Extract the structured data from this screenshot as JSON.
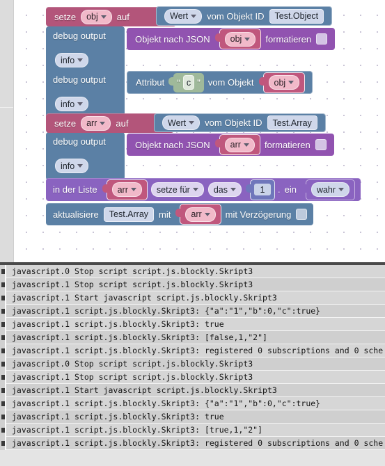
{
  "workspace": {
    "blocks": [
      {
        "id": "set-obj",
        "type": "set-variable",
        "set_label": "setze",
        "variable": "obj",
        "to_label": "auf",
        "value": {
          "type": "get-object-value",
          "mode": "Wert",
          "by_label": "vom Objekt ID",
          "object_id": "Test.Object"
        }
      },
      {
        "id": "debug-json-obj",
        "type": "debug-output",
        "header": "debug output",
        "level": "info",
        "payload": {
          "type": "object-to-json",
          "prefix_label": "Objekt nach JSON",
          "variable": "obj",
          "suffix_label": "formatieren",
          "checkbox_checked": false
        }
      },
      {
        "id": "debug-attr-c",
        "type": "debug-output",
        "header": "debug output",
        "level": "info",
        "payload": {
          "type": "object-attribute",
          "prefix_label": "Attribut",
          "attribute": "c",
          "middle_label": "vom Objekt",
          "variable": "obj"
        }
      },
      {
        "id": "set-arr",
        "type": "set-variable",
        "set_label": "setze",
        "variable": "arr",
        "to_label": "auf",
        "value": {
          "type": "get-object-value",
          "mode": "Wert",
          "by_label": "vom Objekt ID",
          "object_id": "Test.Array"
        }
      },
      {
        "id": "debug-json-arr",
        "type": "debug-output",
        "header": "debug output",
        "level": "info",
        "payload": {
          "type": "object-to-json",
          "prefix_label": "Objekt nach JSON",
          "variable": "arr",
          "suffix_label": "formatieren",
          "checkbox_checked": false
        }
      },
      {
        "id": "list-set",
        "type": "list-set-index",
        "in_list_label": "in der Liste",
        "list_variable": "arr",
        "action": "setze für",
        "position": "das",
        "index": "1",
        "insert_label": "ein",
        "value_variable": "wahr",
        "separator": "."
      },
      {
        "id": "update-state",
        "type": "update-object",
        "update_label": "aktualisiere",
        "object_id": "Test.Array",
        "with_label": "mit",
        "variable": "arr",
        "delay_label": "mit Verzögerung",
        "delay_checked": false
      }
    ],
    "colors": {
      "set_variable": "#b3557a",
      "debug_output": "#5b80a5",
      "object_to_json": "#9153b0",
      "list_block": "#8a63c0",
      "value_block": "#5b80a5",
      "variable_field": "#c0577d"
    }
  },
  "log": {
    "rows": [
      {
        "source": "javascript.0",
        "message": "Stop script script.js.blockly.Skript3",
        "text": "javascript.0 Stop script script.js.blockly.Skript3"
      },
      {
        "source": "javascript.1",
        "message": "Stop script script.js.blockly.Skript3",
        "text": "javascript.1 Stop script script.js.blockly.Skript3"
      },
      {
        "source": "javascript.1",
        "message": "Start javascript script.js.blockly.Skript3",
        "text": "javascript.1 Start javascript script.js.blockly.Skript3"
      },
      {
        "source": "javascript.1",
        "message": "script.js.blockly.Skript3: {\"a\":\"1\",\"b\":0,\"c\":true}",
        "text": "javascript.1 script.js.blockly.Skript3: {\"a\":\"1\",\"b\":0,\"c\":true}"
      },
      {
        "source": "javascript.1",
        "message": "script.js.blockly.Skript3: true",
        "text": "javascript.1 script.js.blockly.Skript3: true"
      },
      {
        "source": "javascript.1",
        "message": "script.js.blockly.Skript3: [false,1,\"2\"]",
        "text": "javascript.1 script.js.blockly.Skript3: [false,1,\"2\"]"
      },
      {
        "source": "javascript.1",
        "message": "script.js.blockly.Skript3: registered 0 subscriptions and 0 sche",
        "text": "javascript.1 script.js.blockly.Skript3: registered 0 subscriptions and 0 sche"
      },
      {
        "source": "javascript.0",
        "message": "Stop script script.js.blockly.Skript3",
        "text": "javascript.0 Stop script script.js.blockly.Skript3"
      },
      {
        "source": "javascript.1",
        "message": "Stop script script.js.blockly.Skript3",
        "text": "javascript.1 Stop script script.js.blockly.Skript3"
      },
      {
        "source": "javascript.1",
        "message": "Start javascript script.js.blockly.Skript3",
        "text": "javascript.1 Start javascript script.js.blockly.Skript3"
      },
      {
        "source": "javascript.1",
        "message": "script.js.blockly.Skript3: {\"a\":\"1\",\"b\":0,\"c\":true}",
        "text": "javascript.1 script.js.blockly.Skript3: {\"a\":\"1\",\"b\":0,\"c\":true}"
      },
      {
        "source": "javascript.1",
        "message": "script.js.blockly.Skript3: true",
        "text": "javascript.1 script.js.blockly.Skript3: true"
      },
      {
        "source": "javascript.1",
        "message": "script.js.blockly.Skript3: [true,1,\"2\"]",
        "text": "javascript.1 script.js.blockly.Skript3: [true,1,\"2\"]"
      },
      {
        "source": "javascript.1",
        "message": "script.js.blockly.Skript3: registered 0 subscriptions and 0 sche",
        "text": "javascript.1 script.js.blockly.Skript3: registered 0 subscriptions and 0 sche"
      }
    ]
  }
}
